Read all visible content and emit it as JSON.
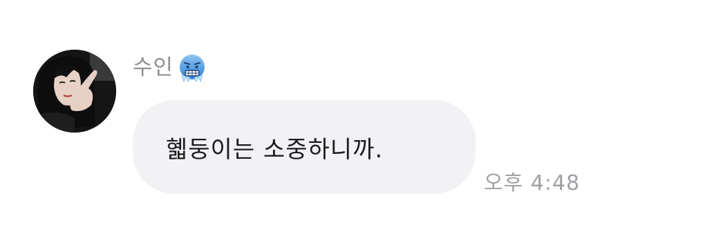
{
  "message": {
    "sender_name": "수인",
    "sender_emoji": "cold-face-emoji",
    "avatar": "profile-photo",
    "text": "혧둥이는 소중하니까.",
    "timestamp": "오후 4:48"
  },
  "colors": {
    "background": "#ffffff",
    "bubble": "#f2f2f5",
    "sender_name": "#8e8e93",
    "message_text": "#1c1c1e",
    "timestamp": "#a0a0a5"
  }
}
